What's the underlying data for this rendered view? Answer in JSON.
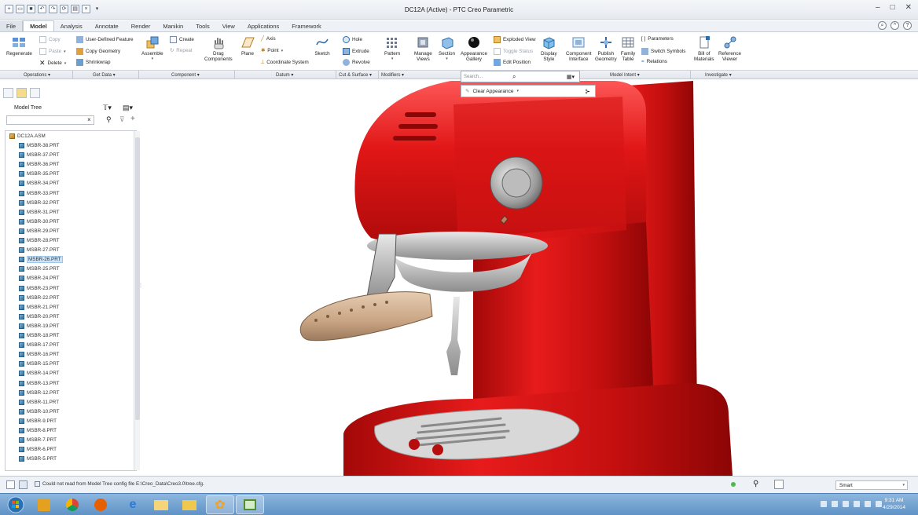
{
  "window": {
    "title": "DC12A (Active) - PTC Creo Parametric"
  },
  "qat": {
    "items": [
      "new",
      "open",
      "save",
      "undo",
      "redo",
      "regenerate",
      "window",
      "close",
      "customize"
    ]
  },
  "tabs": [
    "File",
    "Model",
    "Analysis",
    "Annotate",
    "Render",
    "Manikin",
    "Tools",
    "View",
    "Applications",
    "Framework"
  ],
  "active_tab": "Model",
  "ribbon": {
    "regenerate": "Regenerate",
    "copy": "Copy",
    "paste": "Paste",
    "delete": "Delete",
    "udf": "User-Defined Feature",
    "copy_geometry": "Copy Geometry",
    "shrinkwrap": "Shrinkwrap",
    "assemble": "Assemble",
    "create": "Create",
    "repeat": "Repeat",
    "drag_line1": "Drag",
    "drag_line2": "Components",
    "plane": "Plane",
    "axis": "Axis",
    "point": "Point",
    "coord_sys": "Coordinate System",
    "sketch": "Sketch",
    "hole": "Hole",
    "extrude": "Extrude",
    "revolve": "Revolve",
    "pattern": "Pattern",
    "manage_views_1": "Manage",
    "manage_views_2": "Views",
    "section": "Section",
    "appearance_1": "Appearance",
    "appearance_2": "Gallery",
    "exploded_view": "Exploded View",
    "toggle_status": "Toggle Status",
    "edit_position": "Edit Position",
    "display_style_1": "Display",
    "display_style_2": "Style",
    "comp_interface_1": "Component",
    "comp_interface_2": "Interface",
    "publish_1": "Publish",
    "publish_2": "Geometry",
    "family_1": "Family",
    "family_2": "Table",
    "parameters": "Parameters",
    "switch_symbols": "Switch Symbols",
    "relations": "Relations",
    "bom_1": "Bill of",
    "bom_2": "Materials",
    "refviewer_1": "Reference",
    "refviewer_2": "Viewer"
  },
  "groups": [
    "Operations",
    "Get Data",
    "Component",
    "Datum",
    "Cut & Surface",
    "Modifiers",
    "Model Intent",
    "Investigate"
  ],
  "float_search": {
    "placeholder": "Search..."
  },
  "clear_appearance": "Clear Appearance",
  "model_tree": {
    "title": "Model Tree",
    "root": "DC12A.ASM",
    "items": [
      "MSBR-38.PRT",
      "MSBR-37.PRT",
      "MSBR-36.PRT",
      "MSBR-35.PRT",
      "MSBR-34.PRT",
      "MSBR-33.PRT",
      "MSBR-32.PRT",
      "MSBR-31.PRT",
      "MSBR-30.PRT",
      "MSBR-29.PRT",
      "MSBR-28.PRT",
      "MSBR-27.PRT",
      "MSBR-26.PRT",
      "MSBR-25.PRT",
      "MSBR-24.PRT",
      "MSBR-23.PRT",
      "MSBR-22.PRT",
      "MSBR-21.PRT",
      "MSBR-20.PRT",
      "MSBR-19.PRT",
      "MSBR-18.PRT",
      "MSBR-17.PRT",
      "MSBR-16.PRT",
      "MSBR-15.PRT",
      "MSBR-14.PRT",
      "MSBR-13.PRT",
      "MSBR-12.PRT",
      "MSBR-11.PRT",
      "MSBR-10.PRT",
      "MSBR-9.PRT",
      "MSBR-8.PRT",
      "MSBR-7.PRT",
      "MSBR-6.PRT",
      "MSBR-5.PRT"
    ],
    "selected": "MSBR-26.PRT"
  },
  "status": {
    "message": "Could not read from Model Tree config file E:\\Creo_Data\\Creo3.0\\tree.cfg.",
    "filter": "Smart"
  },
  "clock": {
    "time": "9:31 AM",
    "date": "4/29/2014"
  },
  "colors": {
    "accent": "#2b6cb0",
    "body_red": "#d41414",
    "selection": "#cde4f7"
  }
}
